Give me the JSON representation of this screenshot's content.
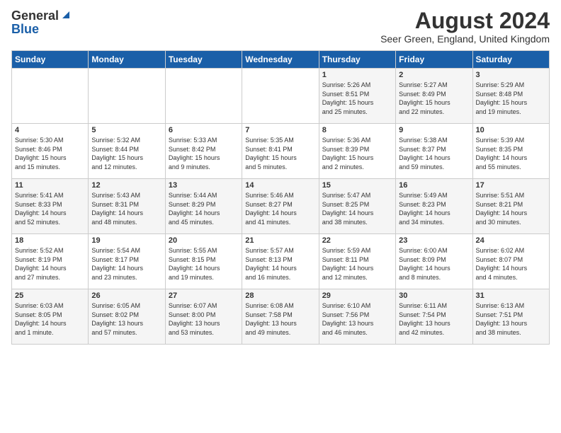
{
  "header": {
    "logo_general": "General",
    "logo_blue": "Blue",
    "title": "August 2024",
    "location": "Seer Green, England, United Kingdom"
  },
  "calendar": {
    "days_of_week": [
      "Sunday",
      "Monday",
      "Tuesday",
      "Wednesday",
      "Thursday",
      "Friday",
      "Saturday"
    ],
    "weeks": [
      [
        {
          "day": "",
          "content": ""
        },
        {
          "day": "",
          "content": ""
        },
        {
          "day": "",
          "content": ""
        },
        {
          "day": "",
          "content": ""
        },
        {
          "day": "1",
          "content": "Sunrise: 5:26 AM\nSunset: 8:51 PM\nDaylight: 15 hours\nand 25 minutes."
        },
        {
          "day": "2",
          "content": "Sunrise: 5:27 AM\nSunset: 8:49 PM\nDaylight: 15 hours\nand 22 minutes."
        },
        {
          "day": "3",
          "content": "Sunrise: 5:29 AM\nSunset: 8:48 PM\nDaylight: 15 hours\nand 19 minutes."
        }
      ],
      [
        {
          "day": "4",
          "content": "Sunrise: 5:30 AM\nSunset: 8:46 PM\nDaylight: 15 hours\nand 15 minutes."
        },
        {
          "day": "5",
          "content": "Sunrise: 5:32 AM\nSunset: 8:44 PM\nDaylight: 15 hours\nand 12 minutes."
        },
        {
          "day": "6",
          "content": "Sunrise: 5:33 AM\nSunset: 8:42 PM\nDaylight: 15 hours\nand 9 minutes."
        },
        {
          "day": "7",
          "content": "Sunrise: 5:35 AM\nSunset: 8:41 PM\nDaylight: 15 hours\nand 5 minutes."
        },
        {
          "day": "8",
          "content": "Sunrise: 5:36 AM\nSunset: 8:39 PM\nDaylight: 15 hours\nand 2 minutes."
        },
        {
          "day": "9",
          "content": "Sunrise: 5:38 AM\nSunset: 8:37 PM\nDaylight: 14 hours\nand 59 minutes."
        },
        {
          "day": "10",
          "content": "Sunrise: 5:39 AM\nSunset: 8:35 PM\nDaylight: 14 hours\nand 55 minutes."
        }
      ],
      [
        {
          "day": "11",
          "content": "Sunrise: 5:41 AM\nSunset: 8:33 PM\nDaylight: 14 hours\nand 52 minutes."
        },
        {
          "day": "12",
          "content": "Sunrise: 5:43 AM\nSunset: 8:31 PM\nDaylight: 14 hours\nand 48 minutes."
        },
        {
          "day": "13",
          "content": "Sunrise: 5:44 AM\nSunset: 8:29 PM\nDaylight: 14 hours\nand 45 minutes."
        },
        {
          "day": "14",
          "content": "Sunrise: 5:46 AM\nSunset: 8:27 PM\nDaylight: 14 hours\nand 41 minutes."
        },
        {
          "day": "15",
          "content": "Sunrise: 5:47 AM\nSunset: 8:25 PM\nDaylight: 14 hours\nand 38 minutes."
        },
        {
          "day": "16",
          "content": "Sunrise: 5:49 AM\nSunset: 8:23 PM\nDaylight: 14 hours\nand 34 minutes."
        },
        {
          "day": "17",
          "content": "Sunrise: 5:51 AM\nSunset: 8:21 PM\nDaylight: 14 hours\nand 30 minutes."
        }
      ],
      [
        {
          "day": "18",
          "content": "Sunrise: 5:52 AM\nSunset: 8:19 PM\nDaylight: 14 hours\nand 27 minutes."
        },
        {
          "day": "19",
          "content": "Sunrise: 5:54 AM\nSunset: 8:17 PM\nDaylight: 14 hours\nand 23 minutes."
        },
        {
          "day": "20",
          "content": "Sunrise: 5:55 AM\nSunset: 8:15 PM\nDaylight: 14 hours\nand 19 minutes."
        },
        {
          "day": "21",
          "content": "Sunrise: 5:57 AM\nSunset: 8:13 PM\nDaylight: 14 hours\nand 16 minutes."
        },
        {
          "day": "22",
          "content": "Sunrise: 5:59 AM\nSunset: 8:11 PM\nDaylight: 14 hours\nand 12 minutes."
        },
        {
          "day": "23",
          "content": "Sunrise: 6:00 AM\nSunset: 8:09 PM\nDaylight: 14 hours\nand 8 minutes."
        },
        {
          "day": "24",
          "content": "Sunrise: 6:02 AM\nSunset: 8:07 PM\nDaylight: 14 hours\nand 4 minutes."
        }
      ],
      [
        {
          "day": "25",
          "content": "Sunrise: 6:03 AM\nSunset: 8:05 PM\nDaylight: 14 hours\nand 1 minute."
        },
        {
          "day": "26",
          "content": "Sunrise: 6:05 AM\nSunset: 8:02 PM\nDaylight: 13 hours\nand 57 minutes."
        },
        {
          "day": "27",
          "content": "Sunrise: 6:07 AM\nSunset: 8:00 PM\nDaylight: 13 hours\nand 53 minutes."
        },
        {
          "day": "28",
          "content": "Sunrise: 6:08 AM\nSunset: 7:58 PM\nDaylight: 13 hours\nand 49 minutes."
        },
        {
          "day": "29",
          "content": "Sunrise: 6:10 AM\nSunset: 7:56 PM\nDaylight: 13 hours\nand 46 minutes."
        },
        {
          "day": "30",
          "content": "Sunrise: 6:11 AM\nSunset: 7:54 PM\nDaylight: 13 hours\nand 42 minutes."
        },
        {
          "day": "31",
          "content": "Sunrise: 6:13 AM\nSunset: 7:51 PM\nDaylight: 13 hours\nand 38 minutes."
        }
      ]
    ]
  }
}
